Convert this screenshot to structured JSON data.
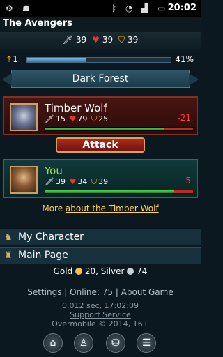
{
  "statusbar": {
    "time": "20:02"
  },
  "app": {
    "title": "The Avengers"
  },
  "player_stats": {
    "attack": "39",
    "health": "39",
    "defense": "39"
  },
  "xp": {
    "level": "1",
    "percent": "41%",
    "progress": 0.41
  },
  "location": {
    "name": "Dark Forest"
  },
  "enemy": {
    "name": "Timber Wolf",
    "attack": "15",
    "health": "79",
    "defense": "25",
    "damage": "-21",
    "hp_fraction": 0.8
  },
  "attack_button": {
    "label": "Attack"
  },
  "you": {
    "name": "You",
    "attack": "39",
    "health": "34",
    "defense": "39",
    "damage": "-5",
    "hp_fraction": 0.87
  },
  "more_about": {
    "prefix": "More ",
    "link": "about the Timber Wolf"
  },
  "menu": [
    {
      "label": "My Character"
    },
    {
      "label": "Main Page"
    }
  ],
  "currency": {
    "gold_label": "Gold",
    "gold": "20,",
    "silver_label": "Silver",
    "silver": "74"
  },
  "footer": {
    "settings": "Settings",
    "online": "Online: 75",
    "about": "About Game",
    "separator": "|",
    "timing": "0.012 sec, 17:02:09",
    "support": "Support Service",
    "copyright": "Overmobile © 2014, 16+"
  }
}
